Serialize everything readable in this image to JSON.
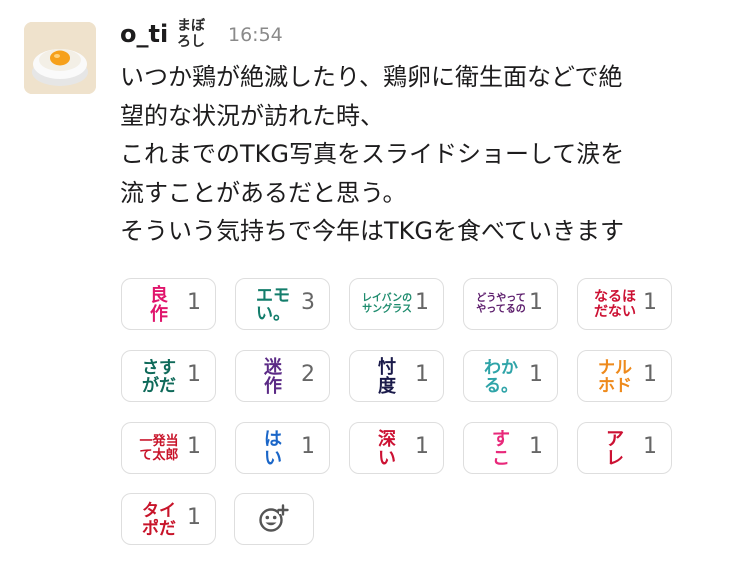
{
  "message": {
    "username": "o_ti",
    "status_emoji": [
      "まぼ",
      "ろし"
    ],
    "timestamp": "16:54",
    "lines": [
      "いつか鶏が絶滅したり、鶏卵に衛生面などで絶",
      "望的な状況が訪れた時、",
      "これまでのTKG写真をスライドショーして涙を",
      "流すことがあるだと思う。",
      "そういう気持ちで今年はTKGを食べていきます"
    ]
  },
  "reactions": [
    {
      "emoji_lines": [
        "良",
        "作"
      ],
      "count": "1",
      "color": "#e0156c",
      "font_size": 18
    },
    {
      "emoji_lines": [
        "エモ",
        "い。"
      ],
      "count": "3",
      "color": "#137d6b",
      "font_size": 17
    },
    {
      "emoji_lines": [
        "レイバンの",
        "サングラス"
      ],
      "count": "1",
      "color": "#1f8c6e",
      "font_size": 10
    },
    {
      "emoji_lines": [
        "どうやって",
        "やってるの"
      ],
      "count": "1",
      "color": "#5a1a6a",
      "font_size": 10
    },
    {
      "emoji_lines": [
        "なるほ",
        "だない"
      ],
      "count": "1",
      "color": "#cc1133",
      "font_size": 14
    },
    {
      "emoji_lines": [
        "さす",
        "がだ"
      ],
      "count": "1",
      "color": "#0f6a5a",
      "font_size": 17
    },
    {
      "emoji_lines": [
        "迷",
        "作"
      ],
      "count": "2",
      "color": "#5b2a86",
      "font_size": 18
    },
    {
      "emoji_lines": [
        "忖",
        "度"
      ],
      "count": "1",
      "color": "#1a1a4a",
      "font_size": 18
    },
    {
      "emoji_lines": [
        "わか",
        "る。"
      ],
      "count": "1",
      "color": "#2fa4a8",
      "font_size": 17
    },
    {
      "emoji_lines": [
        "ナル",
        "ホド"
      ],
      "count": "1",
      "color": "#ee8a1c",
      "font_size": 17
    },
    {
      "emoji_lines": [
        "一発当",
        "て太郎"
      ],
      "count": "1",
      "color": "#c8142a",
      "font_size": 13
    },
    {
      "emoji_lines": [
        "は",
        "い"
      ],
      "count": "1",
      "color": "#1a66c8",
      "font_size": 18
    },
    {
      "emoji_lines": [
        "深",
        "い"
      ],
      "count": "1",
      "color": "#cc1133",
      "font_size": 18
    },
    {
      "emoji_lines": [
        "す",
        "こ"
      ],
      "count": "1",
      "color": "#e8287a",
      "font_size": 18
    },
    {
      "emoji_lines": [
        "ア",
        "レ"
      ],
      "count": "1",
      "color": "#cc1133",
      "font_size": 18
    },
    {
      "emoji_lines": [
        "タイ",
        "ポだ"
      ],
      "count": "1",
      "color": "#c8142a",
      "font_size": 17
    }
  ],
  "add_reaction_icon": "add-emoji-icon"
}
